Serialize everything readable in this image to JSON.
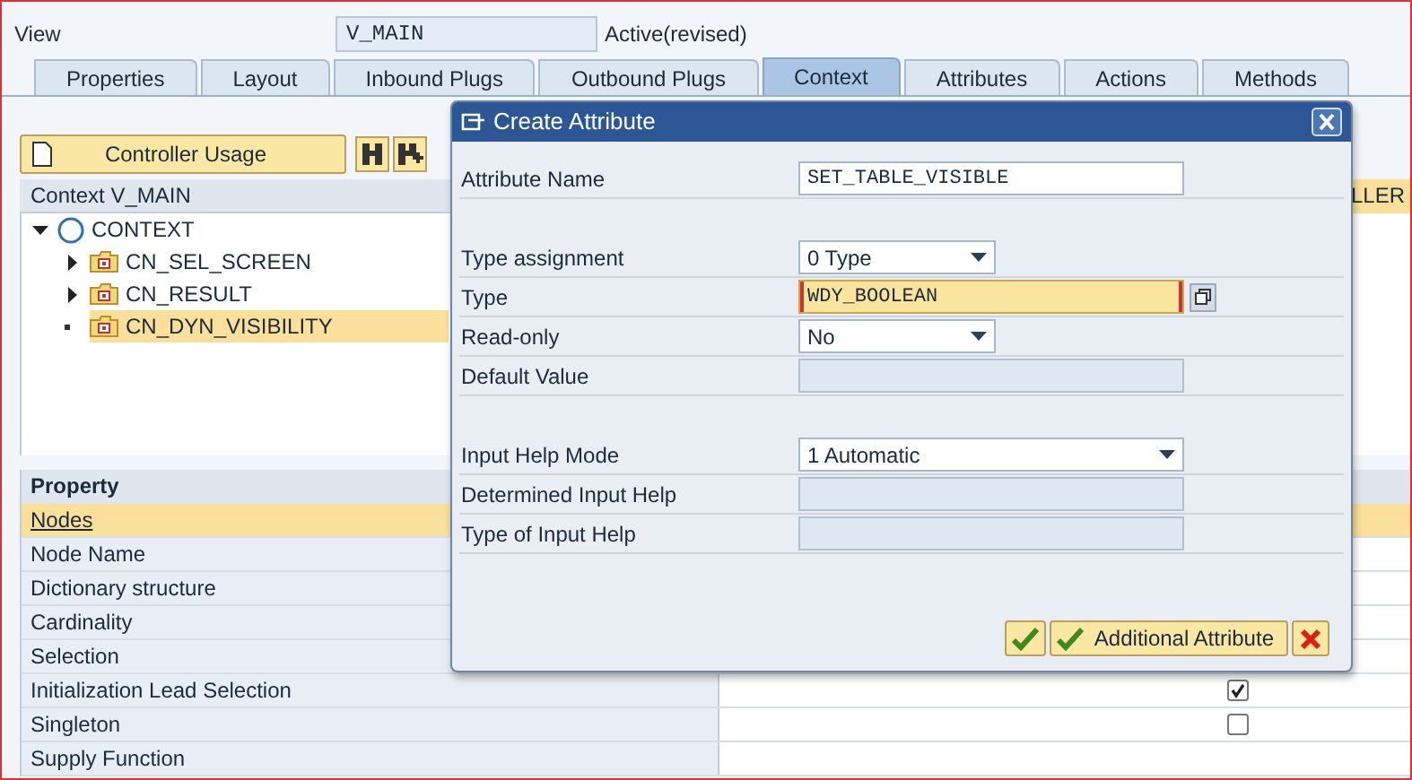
{
  "header": {
    "label": "View",
    "value": "V_MAIN",
    "status": "Active(revised)"
  },
  "tabs": [
    {
      "label": "Properties",
      "selected": false
    },
    {
      "label": "Layout",
      "selected": false
    },
    {
      "label": "Inbound Plugs",
      "selected": false
    },
    {
      "label": "Outbound Plugs",
      "selected": false
    },
    {
      "label": "Context",
      "selected": true
    },
    {
      "label": "Attributes",
      "selected": false
    },
    {
      "label": "Actions",
      "selected": false
    },
    {
      "label": "Methods",
      "selected": false
    }
  ],
  "toolbar": {
    "button": "Controller Usage"
  },
  "context_tree": {
    "title": "Context V_MAIN",
    "column_2": "LLER",
    "nodes": [
      {
        "label": "CONTEXT",
        "kind": "root",
        "expanded": true,
        "selected": false,
        "children": [
          {
            "label": "CN_SEL_SCREEN",
            "kind": "node",
            "expanded": false,
            "selected": false
          },
          {
            "label": "CN_RESULT",
            "kind": "node",
            "expanded": false,
            "selected": false
          },
          {
            "label": "CN_DYN_VISIBILITY",
            "kind": "leaf",
            "selected": true
          }
        ]
      }
    ]
  },
  "property_table": {
    "columns": [
      "Property"
    ],
    "rows": [
      {
        "property": "Nodes",
        "kind": "link",
        "selected": true
      },
      {
        "property": "Node Name",
        "kind": "text",
        "selected": false
      },
      {
        "property": "Dictionary structure",
        "kind": "text",
        "selected": false
      },
      {
        "property": "Cardinality",
        "kind": "text",
        "selected": false
      },
      {
        "property": "Selection",
        "kind": "text",
        "selected": false
      },
      {
        "property": "Initialization Lead Selection",
        "kind": "checkbox",
        "checked": true,
        "selected": false
      },
      {
        "property": "Singleton",
        "kind": "checkbox",
        "checked": false,
        "selected": false
      },
      {
        "property": "Supply Function",
        "kind": "text",
        "selected": false
      }
    ]
  },
  "dialog": {
    "title": "Create Attribute",
    "fields": [
      {
        "label": "Attribute Name",
        "kind": "input",
        "value": "SET_TABLE_VISIBLE"
      },
      {
        "kind": "gap"
      },
      {
        "label": "Type assignment",
        "kind": "dropdown",
        "value": "0 Type"
      },
      {
        "label": "Type",
        "kind": "required",
        "value": "WDY_BOOLEAN"
      },
      {
        "label": "Read-only",
        "kind": "dropdown",
        "value": "No"
      },
      {
        "label": "Default Value",
        "kind": "disabled"
      },
      {
        "kind": "gap"
      },
      {
        "label": "Input Help Mode",
        "kind": "wide_dropdown",
        "value": "1 Automatic"
      },
      {
        "label": "Determined Input Help",
        "kind": "disabled"
      },
      {
        "label": "Type of Input Help",
        "kind": "disabled"
      }
    ],
    "buttons": [
      {
        "kind": "ok"
      },
      {
        "kind": "ok",
        "label": "Additional Attribute"
      },
      {
        "kind": "cancel"
      }
    ]
  }
}
